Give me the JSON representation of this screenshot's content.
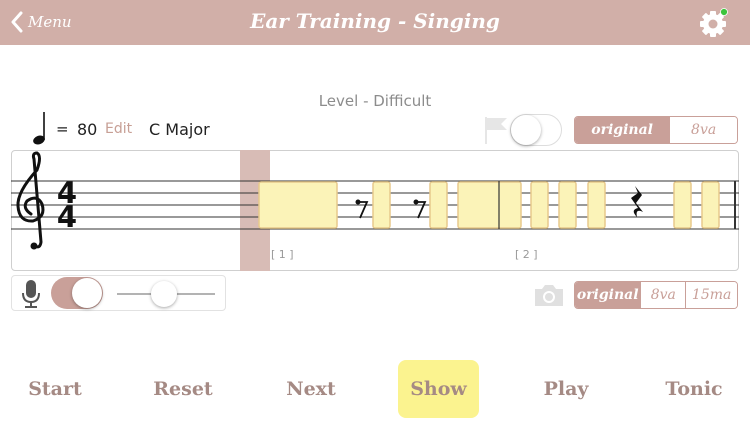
{
  "header": {
    "back_label": "Menu",
    "title": "Ear Training - Singing",
    "settings_icon": "gear-icon",
    "notification_color": "#3cc43c",
    "bar_color": "#d1afa8"
  },
  "level": "Level - Difficult",
  "tempo": {
    "note_icon": "quarter-note-icon",
    "equals": "=",
    "bpm": "80",
    "edit_label": "Edit",
    "key": "C Major"
  },
  "flag_toggle": {
    "icon": "flag-icon",
    "on": false
  },
  "octave_top": {
    "options": [
      "original",
      "8va"
    ],
    "selected": "original"
  },
  "staff": {
    "time_signature": [
      "4",
      "4"
    ],
    "measure_labels": [
      "[ 1 ]",
      "[ 2 ]"
    ],
    "highlight_color": "#fbf3b8",
    "playhead_color": "#d8bcb6"
  },
  "mic": {
    "icon": "microphone-icon",
    "toggle_on": true,
    "level": 0.47
  },
  "camera_icon": "camera-icon",
  "octave_bottom": {
    "options": [
      "original",
      "8va",
      "15ma"
    ],
    "selected": "original"
  },
  "buttons": {
    "start": "Start",
    "reset": "Reset",
    "next": "Next",
    "show": "Show",
    "play": "Play",
    "tonic": "Tonic"
  },
  "colors": {
    "accent": "#c9a099",
    "highlight": "#fbf38f",
    "button_text": "#a58a84"
  }
}
